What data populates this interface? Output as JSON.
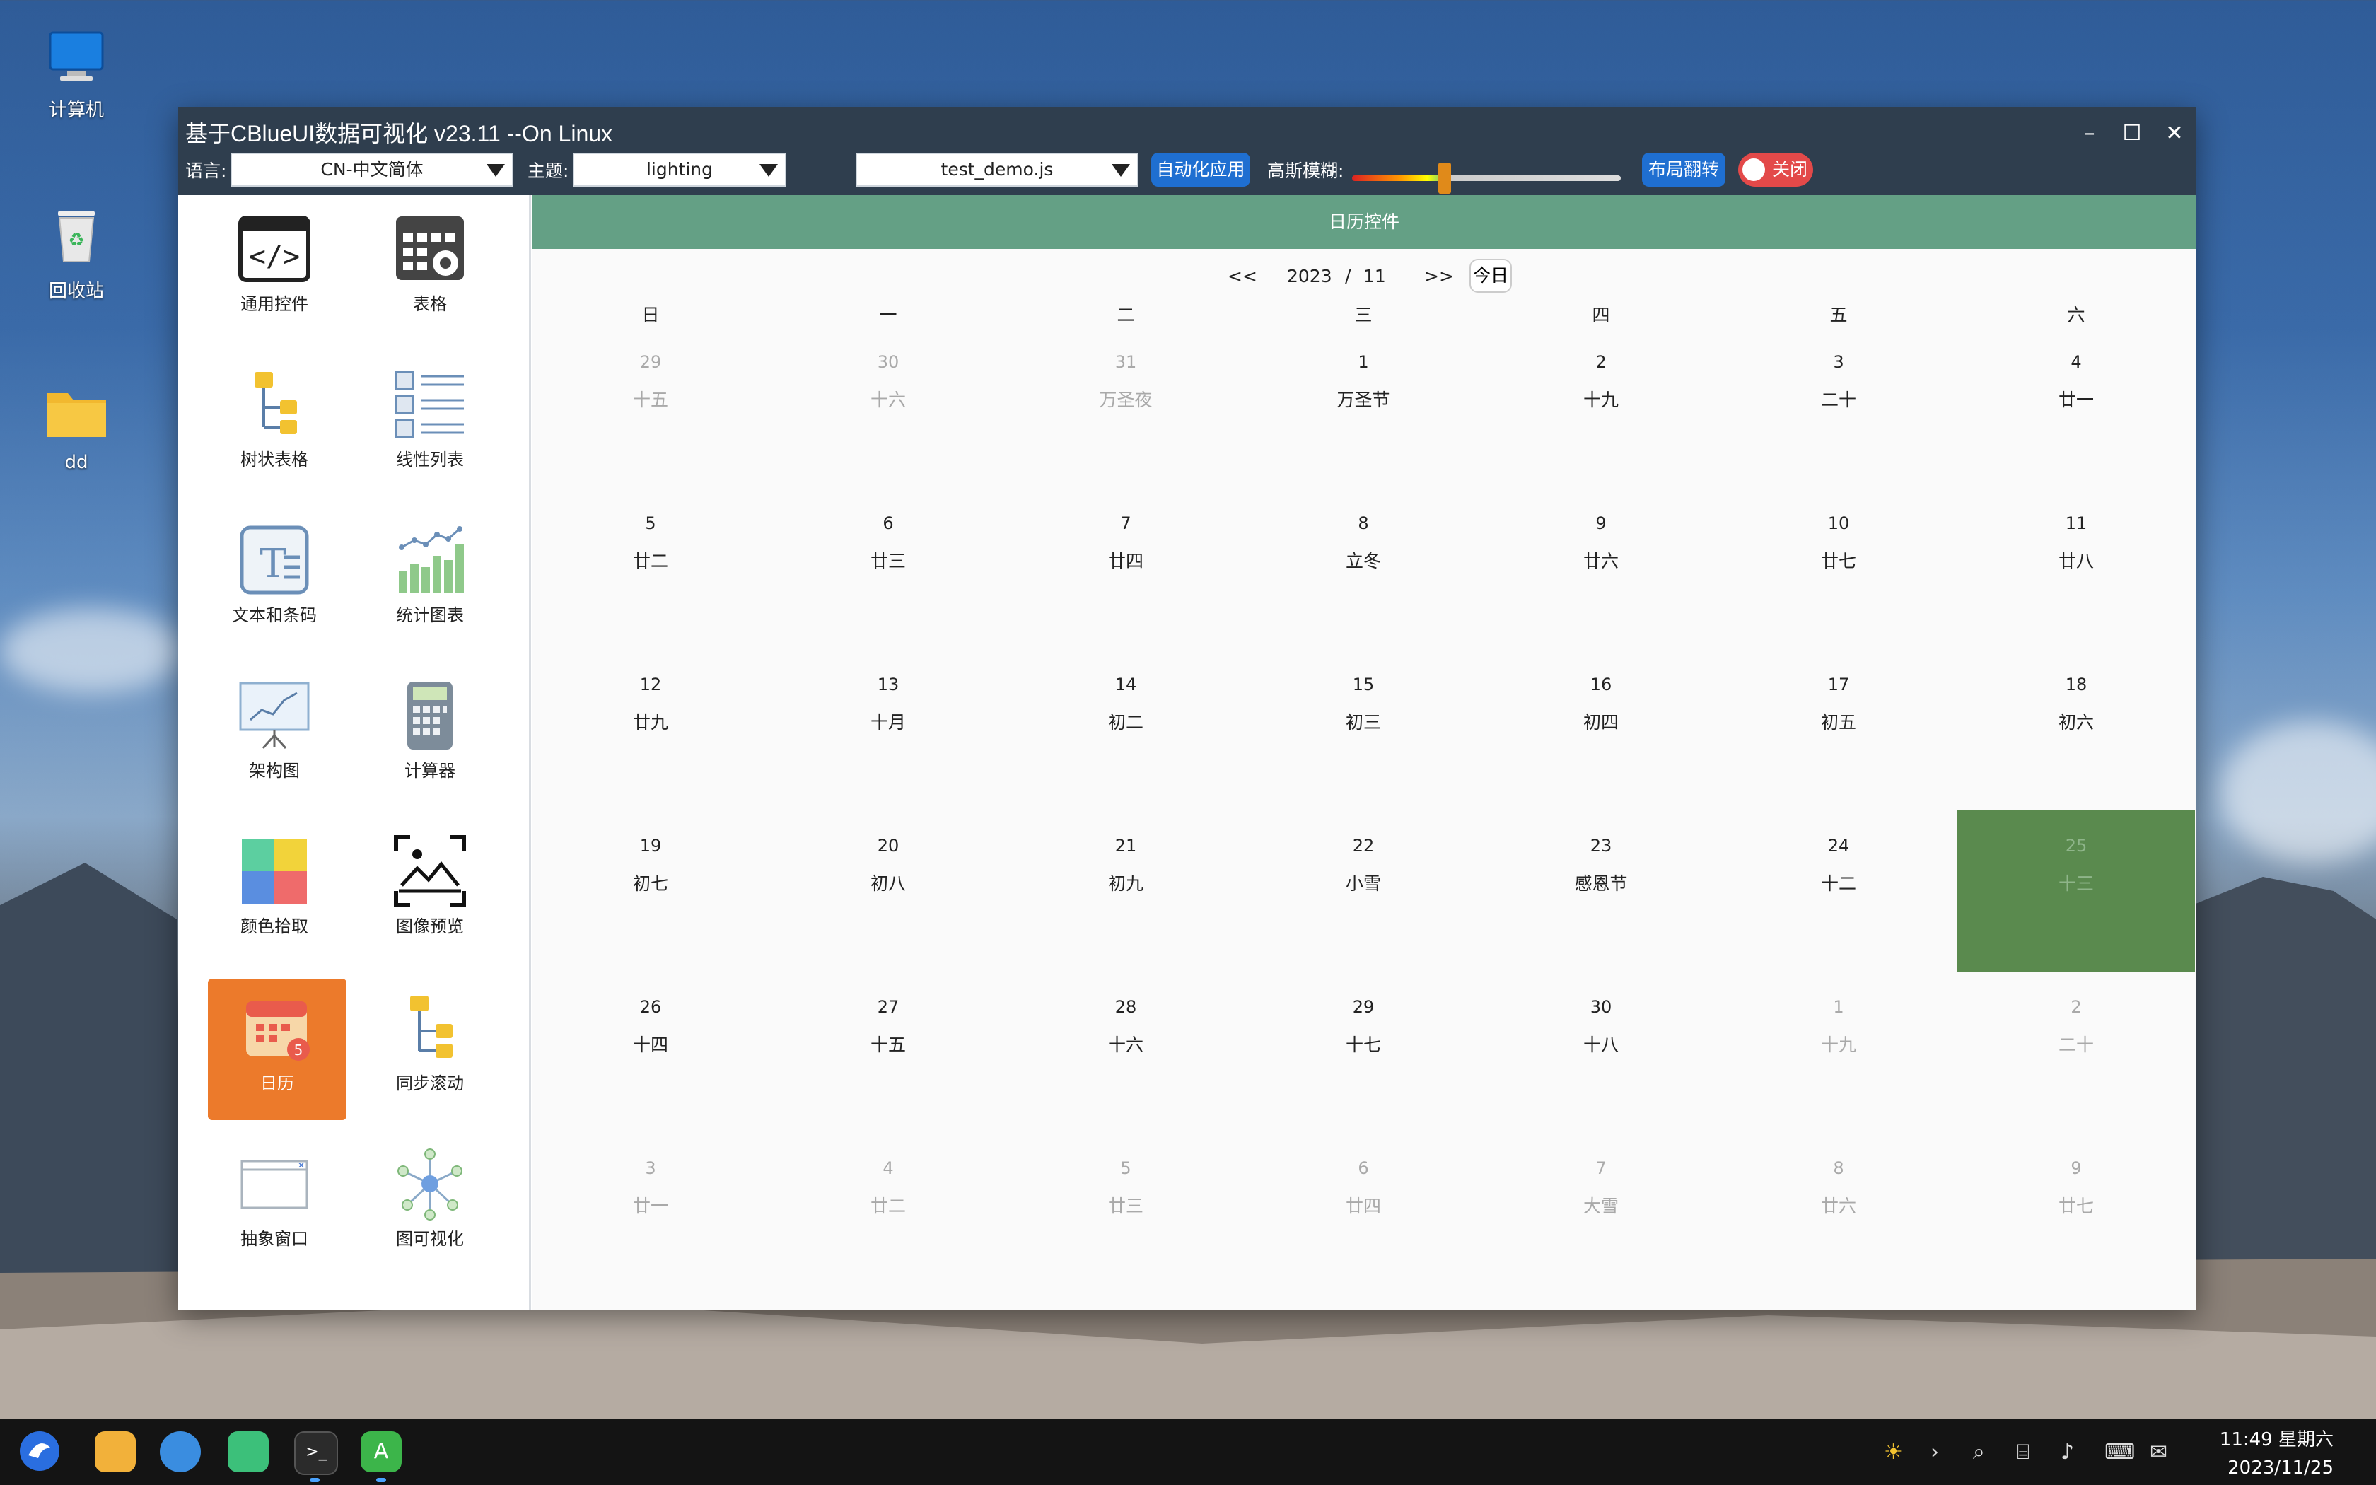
{
  "desktop": {
    "icons": [
      {
        "label": "计算机"
      },
      {
        "label": "回收站"
      },
      {
        "label": "dd"
      }
    ]
  },
  "window": {
    "title": "基于CBlueUI数据可视化 v23.11 --On Linux",
    "toolbar": {
      "language_label": "语言:",
      "language_value": "CN-中文简体",
      "theme_label": "主题:",
      "theme_value": "lighting",
      "script_value": "test_demo.js",
      "auto_apply": "自动化应用",
      "blur_label": "高斯模糊:",
      "layout_flip": "布局翻转",
      "toggle_label": "关闭"
    }
  },
  "sidebar": {
    "items": [
      {
        "label": "通用控件"
      },
      {
        "label": "表格"
      },
      {
        "label": "树状表格"
      },
      {
        "label": "线性列表"
      },
      {
        "label": "文本和条码"
      },
      {
        "label": "统计图表"
      },
      {
        "label": "架构图"
      },
      {
        "label": "计算器"
      },
      {
        "label": "颜色拾取"
      },
      {
        "label": "图像预览"
      },
      {
        "label": "日历"
      },
      {
        "label": "同步滚动"
      },
      {
        "label": "抽象窗口"
      },
      {
        "label": "图可视化"
      }
    ],
    "active_index": 10
  },
  "calendar": {
    "header": "日历控件",
    "prev": "<<",
    "next": ">>",
    "year": "2023",
    "sep": "/",
    "month": "11",
    "today": "今日",
    "weekdays": [
      "日",
      "一",
      "二",
      "三",
      "四",
      "五",
      "六"
    ],
    "weeks": [
      [
        {
          "d": "29",
          "l": "十五",
          "dim": true
        },
        {
          "d": "30",
          "l": "十六",
          "dim": true
        },
        {
          "d": "31",
          "l": "万圣夜",
          "dim": true
        },
        {
          "d": "1",
          "l": "万圣节"
        },
        {
          "d": "2",
          "l": "十九"
        },
        {
          "d": "3",
          "l": "二十"
        },
        {
          "d": "4",
          "l": "廿一"
        }
      ],
      [
        {
          "d": "5",
          "l": "廿二"
        },
        {
          "d": "6",
          "l": "廿三"
        },
        {
          "d": "7",
          "l": "廿四"
        },
        {
          "d": "8",
          "l": "立冬"
        },
        {
          "d": "9",
          "l": "廿六"
        },
        {
          "d": "10",
          "l": "廿七"
        },
        {
          "d": "11",
          "l": "廿八"
        }
      ],
      [
        {
          "d": "12",
          "l": "廿九"
        },
        {
          "d": "13",
          "l": "十月"
        },
        {
          "d": "14",
          "l": "初二"
        },
        {
          "d": "15",
          "l": "初三"
        },
        {
          "d": "16",
          "l": "初四"
        },
        {
          "d": "17",
          "l": "初五"
        },
        {
          "d": "18",
          "l": "初六"
        }
      ],
      [
        {
          "d": "19",
          "l": "初七"
        },
        {
          "d": "20",
          "l": "初八"
        },
        {
          "d": "21",
          "l": "初九"
        },
        {
          "d": "22",
          "l": "小雪"
        },
        {
          "d": "23",
          "l": "感恩节"
        },
        {
          "d": "24",
          "l": "十二"
        },
        {
          "d": "25",
          "l": "十三",
          "selected": true
        }
      ],
      [
        {
          "d": "26",
          "l": "十四"
        },
        {
          "d": "27",
          "l": "十五"
        },
        {
          "d": "28",
          "l": "十六"
        },
        {
          "d": "29",
          "l": "十七"
        },
        {
          "d": "30",
          "l": "十八"
        },
        {
          "d": "1",
          "l": "十九",
          "dim": true
        },
        {
          "d": "2",
          "l": "二十",
          "dim": true
        }
      ],
      [
        {
          "d": "3",
          "l": "廿一",
          "dim": true
        },
        {
          "d": "4",
          "l": "廿二",
          "dim": true
        },
        {
          "d": "5",
          "l": "廿三",
          "dim": true
        },
        {
          "d": "6",
          "l": "廿四",
          "dim": true
        },
        {
          "d": "7",
          "l": "大雪",
          "dim": true
        },
        {
          "d": "8",
          "l": "廿六",
          "dim": true
        },
        {
          "d": "9",
          "l": "廿七",
          "dim": true
        }
      ]
    ]
  },
  "taskbar": {
    "time": "11:49 星期六",
    "date": "2023/11/25"
  },
  "colors": {
    "header_green": "#64a085",
    "selected_day": "#5a8a4e",
    "active_nav": "#ec7a2b",
    "primary_button": "#1f6fd1",
    "toggle_red": "#e34949"
  }
}
